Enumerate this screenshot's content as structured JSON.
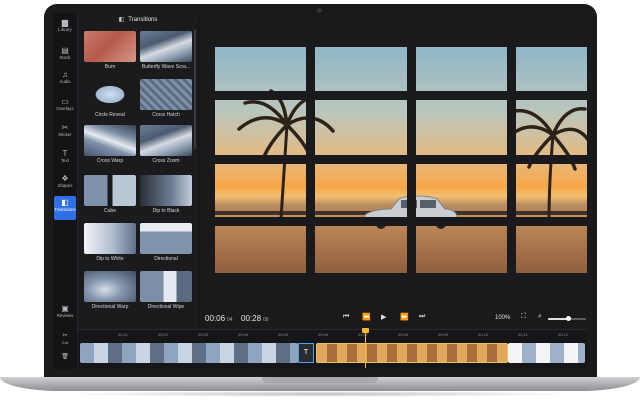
{
  "sidebar": {
    "items": [
      {
        "icon": "folder-icon",
        "glyph": "▆",
        "label": "Library"
      },
      {
        "icon": "stock-icon",
        "glyph": "▤",
        "label": "Stock"
      },
      {
        "icon": "music-note-icon",
        "glyph": "♫",
        "label": "Audio"
      },
      {
        "icon": "overlays-icon",
        "glyph": "▭",
        "label": "Overlays"
      },
      {
        "icon": "sticker-icon",
        "glyph": "✂",
        "label": "Sticker"
      },
      {
        "icon": "text-icon",
        "glyph": "T",
        "label": "Text"
      },
      {
        "icon": "shapes-icon",
        "glyph": "❖",
        "label": "Shapes"
      },
      {
        "icon": "transitions-icon",
        "glyph": "◧",
        "label": "Transitions"
      },
      {
        "icon": "reviews-icon",
        "glyph": "▣",
        "label": "Reviews"
      }
    ]
  },
  "panel": {
    "title": "Transitions",
    "items": [
      {
        "label": "Burn"
      },
      {
        "label": "Butterfly Wave Scra..."
      },
      {
        "label": "Circle Reveal"
      },
      {
        "label": "Cross Hatch"
      },
      {
        "label": "Cross Warp"
      },
      {
        "label": "Cross Zoom"
      },
      {
        "label": "Cube"
      },
      {
        "label": "Dip to Black"
      },
      {
        "label": "Dip to White"
      },
      {
        "label": "Directional"
      },
      {
        "label": "Directional Warp"
      },
      {
        "label": "Directional Wipe"
      }
    ]
  },
  "player": {
    "current_time": "00:06",
    "current_frames": "04",
    "total_time": "00:28",
    "total_frames": "00",
    "zoom": "100%",
    "zoom_level": 0.55
  },
  "timeline": {
    "ticks": [
      "00:01",
      "00:02",
      "00:03",
      "00:04",
      "00:05",
      "00:06",
      "00:07",
      "00:08",
      "00:09",
      "00:10",
      "00:11",
      "00:12"
    ],
    "tools": [
      {
        "icon": "scissors-icon",
        "glyph": "✂",
        "label": "Cut"
      },
      {
        "icon": "trash-icon",
        "glyph": "🗑",
        "label": ""
      }
    ],
    "transition_marker": "T"
  }
}
